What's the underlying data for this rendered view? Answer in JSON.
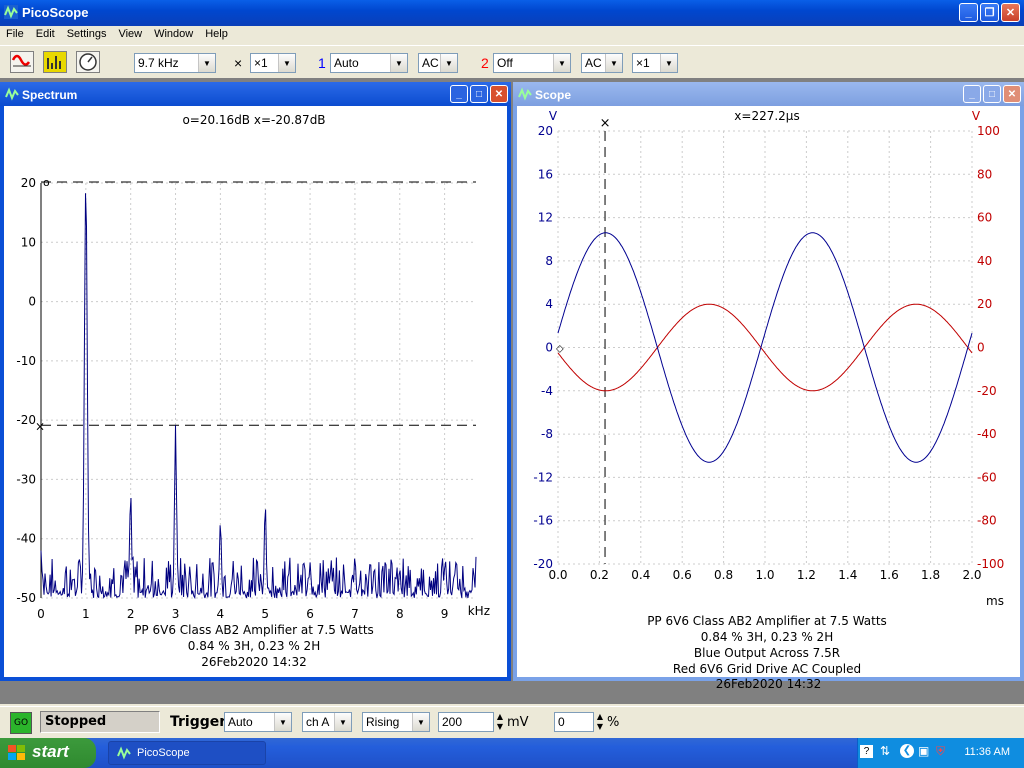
{
  "app": {
    "title": "PicoScope"
  },
  "menu": [
    "File",
    "Edit",
    "Settings",
    "View",
    "Window",
    "Help"
  ],
  "toolbar": {
    "span": "9.7 kHz",
    "multiplier_symbol": "×",
    "zoom": "×1",
    "ch1_label": "1",
    "ch1_range": "Auto",
    "ch1_coupling": "AC",
    "ch2_label": "2",
    "ch2_range": "Off",
    "ch2_coupling": "AC",
    "ch2_zoom": "×1",
    "ch1_color": "#0000ff",
    "ch2_color": "#ff0000"
  },
  "spectrum": {
    "title": "Spectrum",
    "cursor_readout": "o=20.16dB  x=-20.87dB",
    "caption": [
      "PP 6V6 Class AB2 Amplifier at 7.5 Watts",
      "0.84 % 3H, 0.23 % 2H",
      "26Feb2020  14:32"
    ]
  },
  "scope": {
    "title": "Scope",
    "cursor_readout": "x=227.2µs",
    "caption": [
      "PP 6V6 Class AB2 Amplifier at 7.5 Watts",
      "0.84 % 3H, 0.23 % 2H",
      "Blue Output Across 7.5R",
      "Red 6V6 Grid Drive AC Coupled",
      "26Feb2020  14:32"
    ]
  },
  "chart_data": [
    {
      "type": "line",
      "xlabel": "kHz",
      "ylabel": "",
      "xlim": [
        0,
        9.7
      ],
      "ylim": [
        -50,
        20
      ],
      "x_ticks": [
        "0",
        "1",
        "2",
        "3",
        "4",
        "5",
        "6",
        "7",
        "8",
        "9"
      ],
      "y_ticks": [
        "20",
        "10",
        "0",
        "-10",
        "-20",
        "-30",
        "-40",
        "-50"
      ],
      "cursors": {
        "o_db": 20.16,
        "x_db": -20.87
      },
      "series": [
        {
          "color": "#000080",
          "peaks": [
            {
              "x": 0,
              "y": -42
            },
            {
              "x": 1.0,
              "y": 20.16
            },
            {
              "x": 2.0,
              "y": -32
            },
            {
              "x": 3.0,
              "y": -20.87
            },
            {
              "x": 4.0,
              "y": -37
            },
            {
              "x": 5.0,
              "y": -34
            },
            {
              "x": 6.0,
              "y": -44
            },
            {
              "x": 7.0,
              "y": -43
            },
            {
              "x": 8.0,
              "y": -45
            },
            {
              "x": 9.0,
              "y": -45
            }
          ]
        }
      ]
    },
    {
      "type": "line",
      "xlabel": "ms",
      "xlim": [
        0,
        2.0
      ],
      "x_ticks": [
        "0.0",
        "0.2",
        "0.4",
        "0.6",
        "0.8",
        "1.0",
        "1.2",
        "1.4",
        "1.6",
        "1.8",
        "2.0"
      ],
      "left_axis": {
        "unit": "V",
        "ylim": [
          -20,
          20
        ],
        "ticks": [
          "20",
          "16",
          "12",
          "8",
          "4",
          "0",
          "-4",
          "-8",
          "-12",
          "-16",
          "-20"
        ]
      },
      "right_axis": {
        "unit": "V",
        "ylim": [
          -100,
          100
        ],
        "ticks": [
          "100",
          "80",
          "60",
          "40",
          "20",
          "0",
          "-20",
          "-40",
          "-60",
          "-80",
          "-100"
        ]
      },
      "cursor_x_ms": 0.2272,
      "series": [
        {
          "color": "#000090",
          "axis": "left",
          "amplitude": 10.6,
          "period_ms": 1.0,
          "phase_peak_ms": 0.23
        },
        {
          "color": "#c00000",
          "axis": "right",
          "amplitude": 20,
          "period_ms": 1.0,
          "phase_trough_ms": 0.23
        }
      ]
    }
  ],
  "status": {
    "go_label": "GO",
    "state": "Stopped",
    "trigger_label": "Trigger",
    "trigger_mode": "Auto",
    "trigger_channel": "ch A",
    "trigger_edge": "Rising",
    "threshold": "200",
    "threshold_unit": "mV",
    "delay": "0",
    "delay_unit": "%"
  },
  "taskbar": {
    "start": "start",
    "task": "PicoScope",
    "clock": "11:36 AM"
  }
}
